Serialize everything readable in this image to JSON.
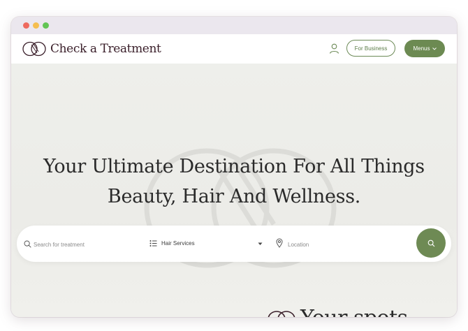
{
  "window": {
    "controls": [
      "close",
      "minimize",
      "maximize"
    ]
  },
  "navbar": {
    "brand": "Check a Treatment",
    "logo_icon": "interlocking-rings-logo",
    "account_icon": "user-icon",
    "for_business_label": "For Business",
    "menus_label": "Menus"
  },
  "hero": {
    "headline_line1": "Your Ultimate Destination For All Things",
    "headline_line2": "Beauty, Hair And Wellness."
  },
  "search": {
    "treatment_placeholder": "Search for treatment",
    "service_selected": "Hair Services",
    "location_placeholder": "Location",
    "submit_icon": "search-icon"
  },
  "below_fold": {
    "partial_heading": "Your spots"
  },
  "colors": {
    "accent_green": "#6c8a52",
    "brand_text": "#3a1f2a",
    "hero_bg": "#eeefeb"
  }
}
